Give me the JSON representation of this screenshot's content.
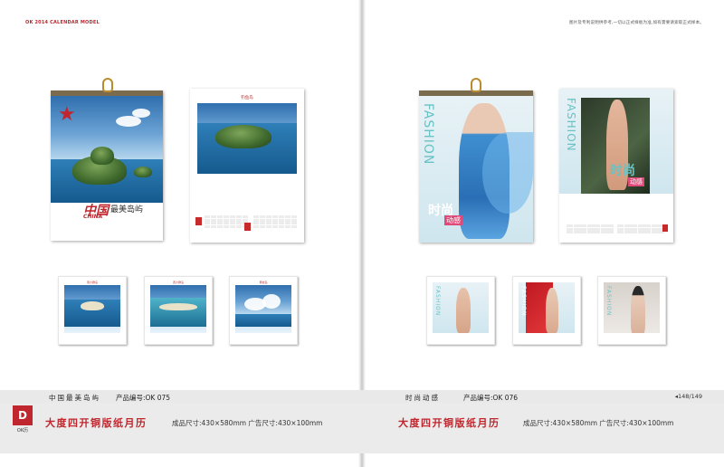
{
  "header": {
    "left_label": "OK 2014 CALENDAR MODEL",
    "right_note": "图片及专利说明供参考,一切以正式样板为准,如有需要请索取正式样本。"
  },
  "left": {
    "wall_calendar": {
      "title_cn": "中国",
      "title_cn2": "最美岛屿",
      "title_en": "CHINA"
    },
    "page_calendar": {
      "caption": "钓鱼岛"
    },
    "thumbs": [
      {
        "caption": "南沙群岛"
      },
      {
        "caption": "西沙群岛"
      },
      {
        "caption": "黄岩岛"
      }
    ],
    "product_name": "中国最美岛屿",
    "product_code_label": "产品编号:OK 075",
    "big_title": "大度四开铜版纸月历",
    "spec": "成品尺寸:430×580mm  广告尺寸:430×100mm"
  },
  "right": {
    "wall_calendar": {
      "brand_vertical": "FASHION",
      "cn_title": "时尚",
      "cn_sub": "动感"
    },
    "page_calendar": {
      "brand_vertical": "FASHION",
      "cn_title": "时尚",
      "cn_sub": "动感"
    },
    "thumbs": [
      {
        "label": "FASHION"
      },
      {
        "label": "FASHION"
      },
      {
        "label": "FASHION"
      }
    ],
    "product_name": "时尚动感",
    "product_code_label": "产品编号:OK 076",
    "big_title": "大度四开铜版纸月历",
    "spec": "成品尺寸:430×580mm  广告尺寸:430×100mm",
    "page_number": "◂148/149"
  },
  "logo": {
    "mark": "D",
    "sub": "OK历"
  },
  "colors": {
    "accent_red": "#c0262d",
    "ring_gold": "#b98c2b",
    "fashion_teal": "#67c3c4"
  }
}
